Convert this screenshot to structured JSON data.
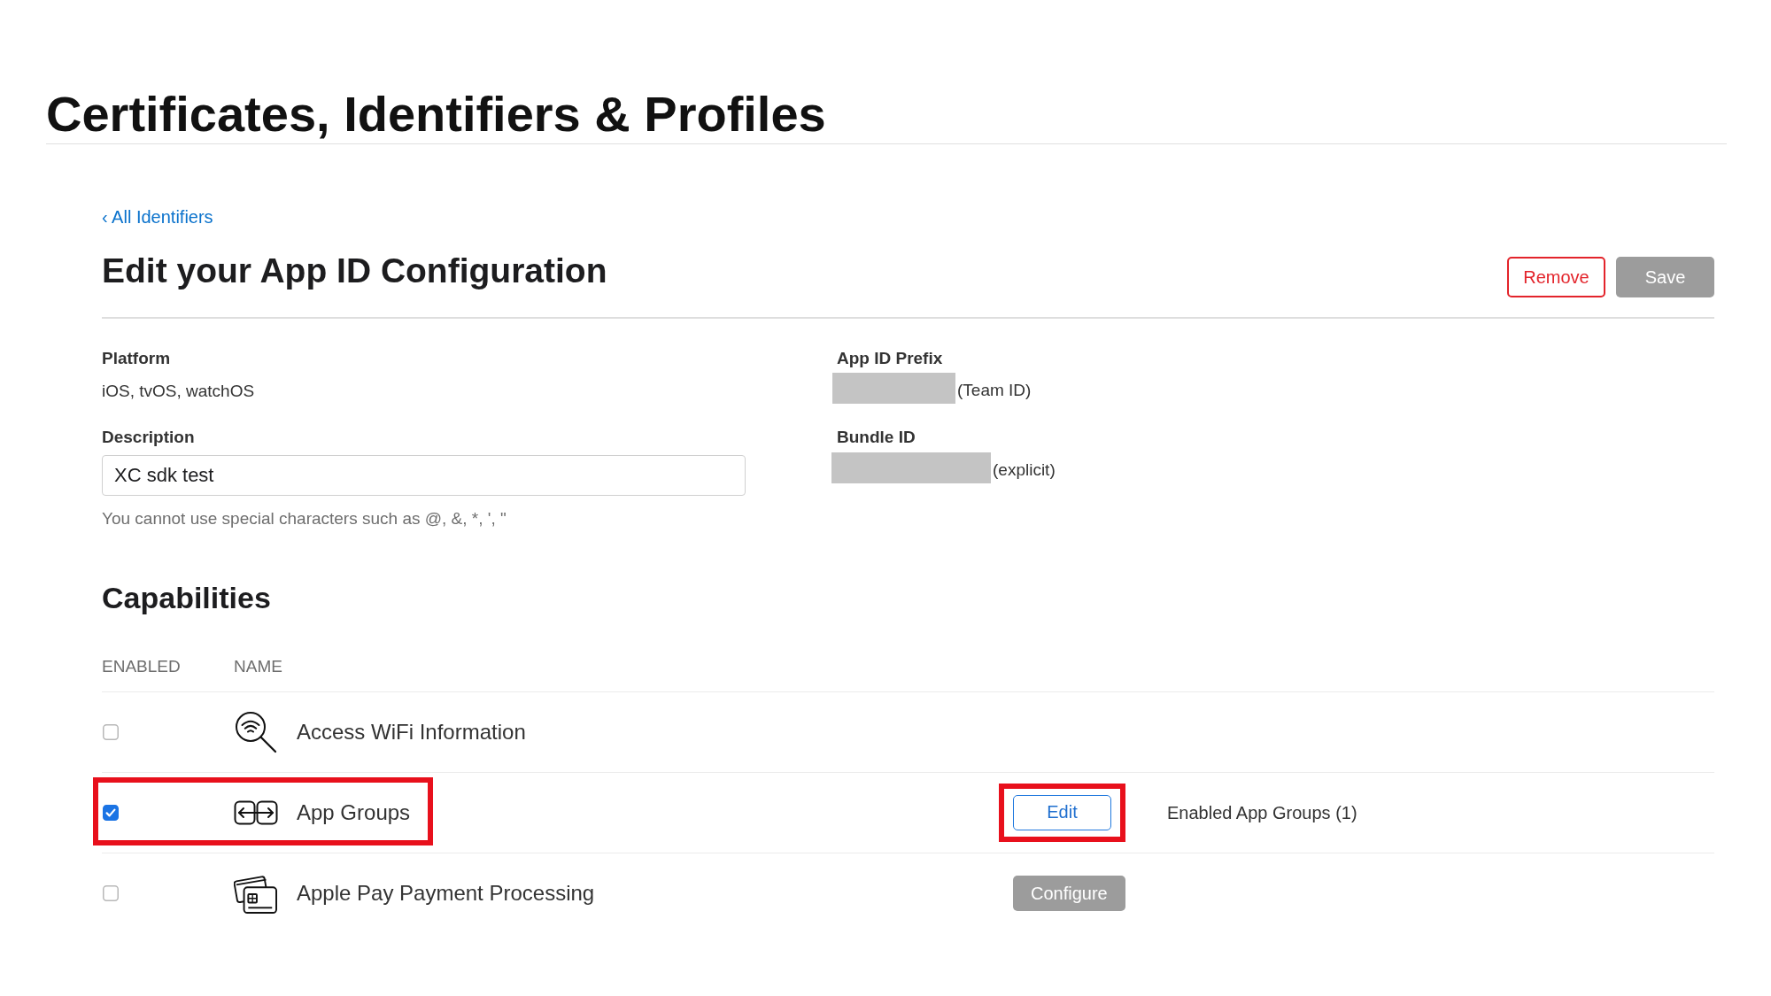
{
  "page_title": "Certificates, Identifiers & Profiles",
  "back_link": "‹ All Identifiers",
  "heading": "Edit your App ID Configuration",
  "header_buttons": [
    {
      "label": "Remove",
      "kind": "destructive",
      "disabled": false
    },
    {
      "label": "Save",
      "kind": "primary",
      "disabled": true
    }
  ],
  "platform": {
    "label": "Platform",
    "value": "iOS, tvOS, watchOS"
  },
  "description": {
    "label": "Description",
    "value": "XC sdk test",
    "hint": "You cannot use special characters such as @, &, *, ', \""
  },
  "identifiers": [
    {
      "label": "App ID Prefix",
      "redacted": true,
      "suffix": "(Team ID)"
    },
    {
      "label": "Bundle ID",
      "redacted": true,
      "suffix": "(explicit)"
    }
  ],
  "capabilities": {
    "title": "Capabilities",
    "columns": [
      "ENABLED",
      "NAME"
    ],
    "rows": [
      {
        "name": "Access WiFi Information",
        "checked": false,
        "highlighted": false
      },
      {
        "name": "App Groups",
        "checked": true,
        "highlighted": true,
        "action": {
          "label": "Edit",
          "disabled": false,
          "highlighted": true
        },
        "note": "Enabled App Groups (1)"
      },
      {
        "name": "Apple Pay Payment Processing",
        "checked": false,
        "highlighted": false,
        "action": {
          "label": "Configure",
          "disabled": true,
          "highlighted": false
        }
      }
    ]
  }
}
